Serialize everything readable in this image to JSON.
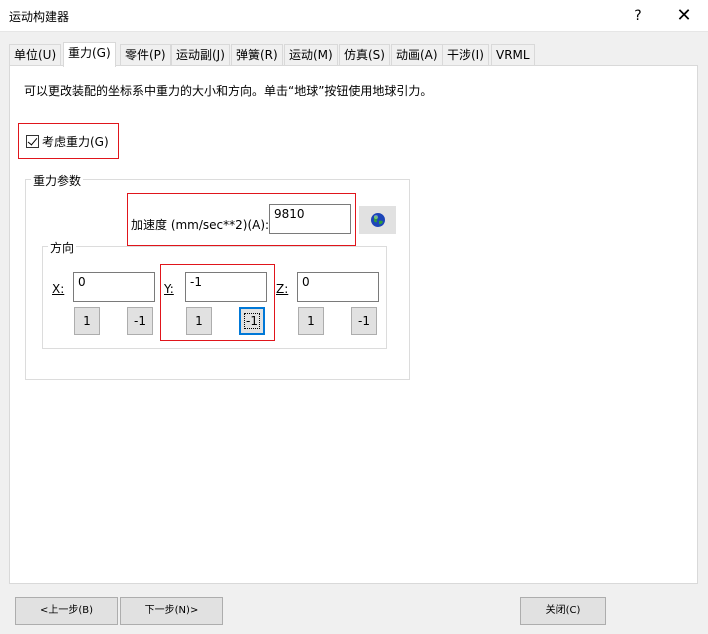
{
  "window": {
    "title": "运动构建器",
    "help": "?",
    "close": "✕"
  },
  "tabs": [
    {
      "label": "单位(U)"
    },
    {
      "label": "重力(G)"
    },
    {
      "label": "零件(P)"
    },
    {
      "label": "运动副(J)"
    },
    {
      "label": "弹簧(R)"
    },
    {
      "label": "运动(M)"
    },
    {
      "label": "仿真(S)"
    },
    {
      "label": "动画(A)"
    },
    {
      "label": "干涉(I)"
    },
    {
      "label": "VRML"
    }
  ],
  "active_tab": "重力(G)",
  "description": "可以更改装配的坐标系中重力的大小和方向。单击“地球”按钮使用地球引力。",
  "consider_gravity": {
    "label": "考虑重力(G)",
    "checked": true
  },
  "gravity_params": {
    "title": "重力参数",
    "acceleration_label": "加速度 (mm/sec**2)(A):",
    "acceleration_value": "9810",
    "earth_button_icon": "globe-icon"
  },
  "direction": {
    "title": "方向",
    "x": {
      "label": "X:",
      "value": "0",
      "btn_pos": "1",
      "btn_neg": "-1"
    },
    "y": {
      "label": "Y:",
      "value": "-1",
      "btn_pos": "1",
      "btn_neg": "-1"
    },
    "z": {
      "label": "Z:",
      "value": "0",
      "btn_pos": "1",
      "btn_neg": "-1"
    }
  },
  "footer": {
    "prev": "<上一步(B)",
    "next": "下一步(N)>",
    "close": "关闭(C)"
  },
  "colors": {
    "highlight": "#e0151b",
    "focus": "#0078d7"
  }
}
